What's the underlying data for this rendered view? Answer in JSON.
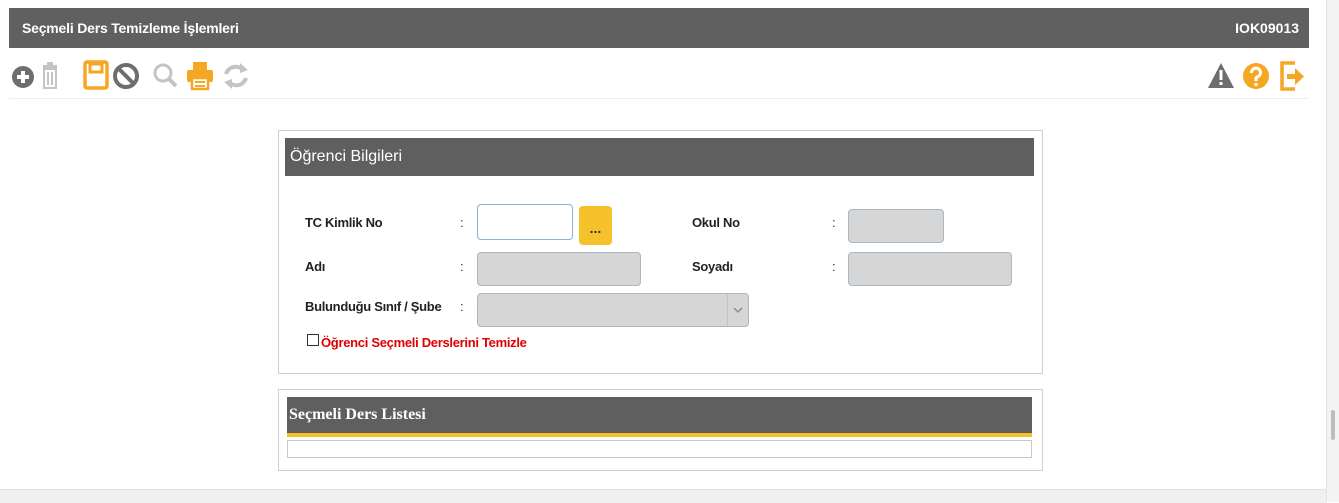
{
  "window": {
    "title": "Seçmeli Ders Temizleme İşlemleri",
    "code": "IOK09013"
  },
  "toolbar": {
    "left_icons": [
      "add-icon",
      "delete-icon",
      "save-icon",
      "cancel-icon",
      "search-icon",
      "print-icon",
      "refresh-icon"
    ],
    "right_icons": [
      "warning-icon",
      "help-icon",
      "exit-icon"
    ],
    "colors": {
      "active": "#f5a623",
      "inactive": "#c4c4c4",
      "dark": "#6e6e6e"
    }
  },
  "student_panel": {
    "title": "Öğrenci Bilgileri",
    "fields": {
      "tc_label": "TC Kimlik No",
      "tc_value": "",
      "lookup_label": "...",
      "okul_label": "Okul No",
      "okul_value": "",
      "adi_label": "Adı",
      "adi_value": "",
      "soyadi_label": "Soyadı",
      "soyadi_value": "",
      "sinif_label": "Bulunduğu Sınıf / Şube",
      "sinif_value": "",
      "colon": ":"
    },
    "clear_checkbox_label": "Öğrenci Seçmeli Derslerini Temizle",
    "clear_checkbox_checked": false
  },
  "list_panel": {
    "title": "Seçmeli Ders Listesi",
    "rows": []
  },
  "colors": {
    "header_bg": "#606060",
    "accent": "#f5c22b",
    "danger_text": "#e00000"
  }
}
